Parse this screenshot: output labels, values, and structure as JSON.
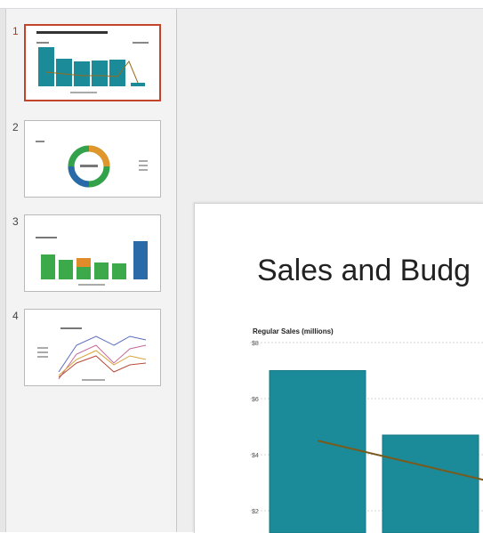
{
  "thumbnails": [
    {
      "number": "1",
      "selected": true
    },
    {
      "number": "2",
      "selected": false
    },
    {
      "number": "3",
      "selected": false
    },
    {
      "number": "4",
      "selected": false
    }
  ],
  "slide": {
    "title": "Sales and Budg",
    "chart_label": "Regular Sales (millions)"
  },
  "chart_data": {
    "type": "bar",
    "ylabel": "Regular Sales (millions)",
    "yticks": [
      "$8",
      "$6",
      "$4",
      "$2"
    ],
    "ylim": [
      1.5,
      8
    ],
    "bar_values": [
      7.0,
      4.7
    ],
    "line_values": [
      4.5,
      3.1
    ],
    "bar_color": "#1b8a99",
    "line_color": "#7a5a1a",
    "grid": true
  },
  "colors": {
    "selected_border": "#c4432b",
    "teal": "#1b8a99"
  }
}
